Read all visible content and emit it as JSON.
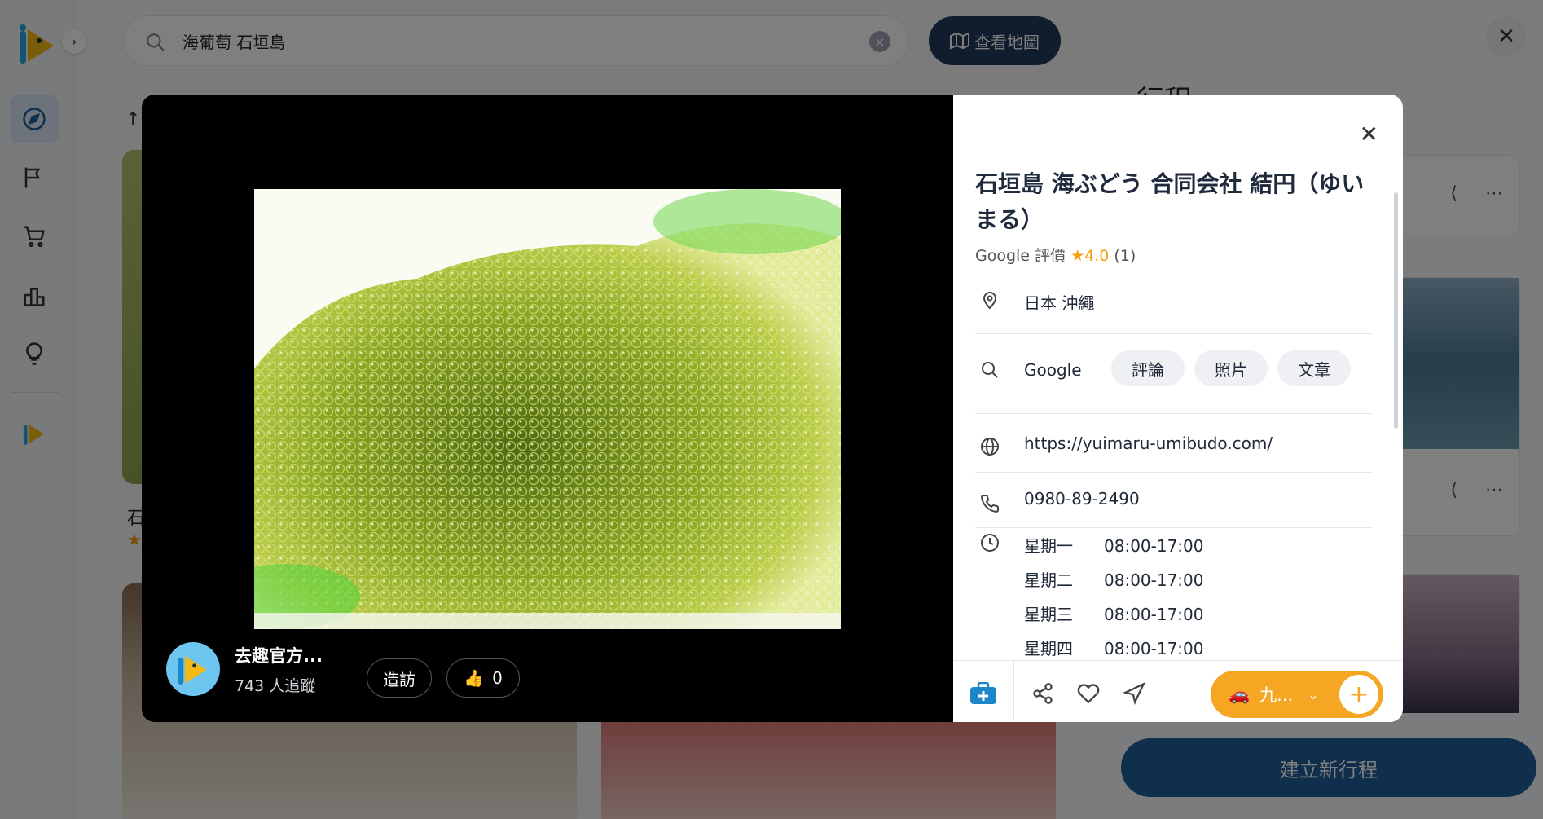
{
  "search": {
    "value": "海葡萄 石垣島"
  },
  "header": {
    "map_button_label": "查看地圖"
  },
  "list": {
    "card1_title": "石",
    "card1_star": "★"
  },
  "right_panel": {
    "title": "行程",
    "new_trip_label": "建立新行程"
  },
  "modal": {
    "author": {
      "name": "去趣官方...",
      "followers": "743 人追蹤"
    },
    "visit_label": "造訪",
    "like_count": "0",
    "place": {
      "title": "石垣島 海ぶどう 合同会社 結円（ゆいまる）",
      "rating_source": "Google 評價",
      "rating_value": "4.0",
      "rating_count": "1",
      "location": "日本 沖繩",
      "search_label": "Google",
      "search_chips": [
        "評論",
        "照片",
        "文章"
      ],
      "website": "https://yuimaru-umibudo.com/",
      "phone": "0980-89-2490",
      "hours": [
        {
          "day": "星期一",
          "time": "08:00-17:00"
        },
        {
          "day": "星期二",
          "time": "08:00-17:00"
        },
        {
          "day": "星期三",
          "time": "08:00-17:00"
        },
        {
          "day": "星期四",
          "time": "08:00-17:00"
        }
      ]
    },
    "trip_select_label": "九..."
  },
  "colors": {
    "accent": "#f5a623",
    "brand_dark": "#1f3a5f",
    "brand_blue": "#1f5f9a",
    "star": "#f59e0b"
  }
}
